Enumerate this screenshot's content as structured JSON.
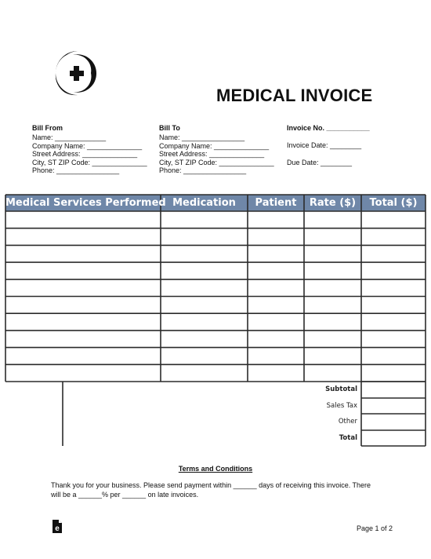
{
  "document": {
    "title": "MEDICAL INVOICE",
    "logo_icon": "medical-cross-crescent-icon",
    "bill_from": {
      "heading": "Bill From",
      "lines": [
        "Name: _____________",
        "Company Name: ______________",
        "Street Address: ______________",
        "City, ST ZIP Code: ______________",
        "Phone: ________________"
      ]
    },
    "bill_to": {
      "heading": "Bill To",
      "lines": [
        "Name: ________________",
        "Company Name: ______________",
        "Street Address: ______________",
        "City, ST ZIP Code: ______________",
        "Phone: ________________"
      ]
    },
    "invoice_info": {
      "invoice_no": "Invoice No. ___________",
      "invoice_date": "Invoice Date: ________",
      "due_date": "Due Date: ________"
    },
    "table": {
      "header_color": "#6f87a8",
      "columns": [
        "Medical Services Performed",
        "Medication",
        "Patient",
        "Rate ($)",
        "Total ($)"
      ],
      "row_count": 10,
      "rows": [
        [
          "",
          "",
          "",
          "",
          ""
        ],
        [
          "",
          "",
          "",
          "",
          ""
        ],
        [
          "",
          "",
          "",
          "",
          ""
        ],
        [
          "",
          "",
          "",
          "",
          ""
        ],
        [
          "",
          "",
          "",
          "",
          ""
        ],
        [
          "",
          "",
          "",
          "",
          ""
        ],
        [
          "",
          "",
          "",
          "",
          ""
        ],
        [
          "",
          "",
          "",
          "",
          ""
        ],
        [
          "",
          "",
          "",
          "",
          ""
        ],
        [
          "",
          "",
          "",
          "",
          ""
        ]
      ]
    },
    "summary": {
      "subtotal_label": "Subtotal",
      "sales_tax_label": "Sales Tax",
      "other_label": "Other",
      "total_label": "Total",
      "subtotal_value": "",
      "sales_tax_value": "",
      "other_value": "",
      "total_value": ""
    },
    "terms": {
      "title": "Terms and Conditions",
      "body": "Thank you for your business. Please send payment within ______ days of receiving this invoice. There will be a ______% per ______ on late invoices."
    },
    "footer": {
      "page_label": "Page 1 of 2",
      "brand_icon": "eforms-document-icon"
    }
  }
}
